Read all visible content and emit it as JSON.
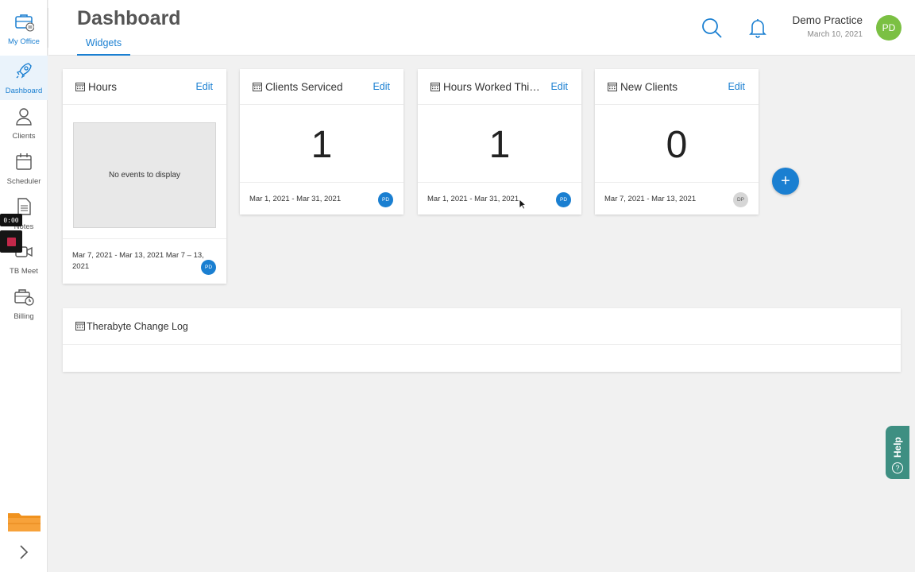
{
  "sidebar": {
    "items": [
      {
        "label": "My Office",
        "icon": "briefcase-icon"
      },
      {
        "label": "Dashboard",
        "icon": "rocket-icon"
      },
      {
        "label": "Clients",
        "icon": "person-icon"
      },
      {
        "label": "Scheduler",
        "icon": "calendar-icon"
      },
      {
        "label": "Notes",
        "icon": "document-icon"
      },
      {
        "label": "TB Meet",
        "icon": "video-camera-icon"
      },
      {
        "label": "Billing",
        "icon": "billing-briefcase-clock-icon"
      }
    ]
  },
  "recording": {
    "timer": "0:00"
  },
  "header": {
    "title": "Dashboard",
    "tab": "Widgets",
    "user_name": "Demo Practice",
    "user_date": "March 10, 2021",
    "user_initials": "PD"
  },
  "widgets": [
    {
      "title": "Hours",
      "edit": "Edit",
      "empty_text": "No events to display",
      "range": "Mar 7, 2021 - Mar 13, 2021 Mar 7 – 13, 2021",
      "avatar": "PD"
    },
    {
      "title": "Clients Serviced",
      "edit": "Edit",
      "value": "1",
      "range": "Mar 1, 2021 - Mar 31, 2021",
      "avatar": "PD"
    },
    {
      "title": "Hours Worked This…",
      "edit": "Edit",
      "value": "1",
      "range": "Mar 1, 2021 - Mar 31, 2021",
      "avatar": "PD"
    },
    {
      "title": "New Clients",
      "edit": "Edit",
      "value": "0",
      "range": "Mar 7, 2021 - Mar 13, 2021",
      "avatar": "DP"
    }
  ],
  "add_button": "+",
  "changelog": {
    "title": "Therabyte Change Log"
  },
  "help": {
    "label": "Help",
    "glyph": "?"
  },
  "colors": {
    "accent": "#1a7fd1",
    "avatar_green": "#7bc043",
    "help_teal": "#3e8f82",
    "folder_orange": "#f0921e"
  }
}
